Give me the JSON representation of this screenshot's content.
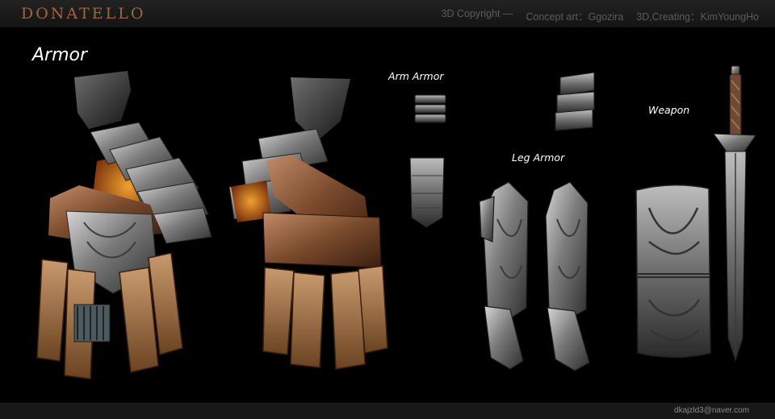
{
  "header": {
    "brand": "DONATELLO",
    "credits": [
      "3D Copyright —",
      "Concept art：Ggozira",
      "3D,Creating：KimYoungHo"
    ]
  },
  "labels": {
    "armor": "Armor",
    "arm_armor": "Arm Armor",
    "leg_armor": "Leg Armor",
    "weapon": "Weapon"
  },
  "footer": {
    "email": "dkajzld3@naver.com"
  },
  "colors": {
    "brand": "#a4633a",
    "leather": "#7a4a2c",
    "steel": "#8c8c8c",
    "ember": "#c45a16"
  }
}
